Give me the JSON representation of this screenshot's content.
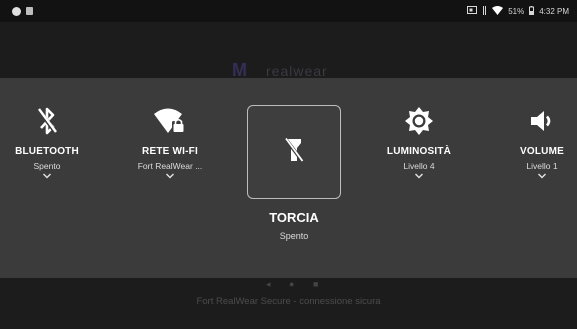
{
  "status_bar": {
    "battery": "51%",
    "time": "4:32 PM"
  },
  "background": {
    "footer_text": "Fort RealWear Secure - connessione sicura"
  },
  "quick_settings": {
    "tiles": [
      {
        "label": "BLUETOOTH",
        "status": "Spento",
        "icon": "bluetooth-off-icon"
      },
      {
        "label": "RETE WI-FI",
        "status": "Fort RealWear ...",
        "icon": "wifi-lock-icon"
      },
      {
        "label": "LUMINOSITÀ",
        "status": "Livello 4",
        "icon": "brightness-icon"
      },
      {
        "label": "VOLUME",
        "status": "Livello 1",
        "icon": "volume-icon"
      }
    ],
    "focused": {
      "label": "TORCIA",
      "status": "Spento",
      "icon": "flashlight-off-icon"
    }
  }
}
